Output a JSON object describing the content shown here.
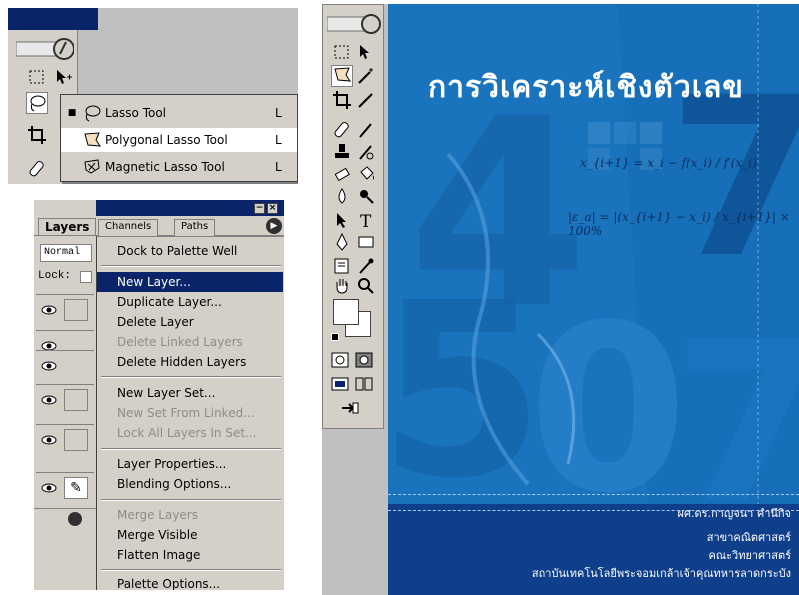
{
  "lasso_panel": {
    "flyout": {
      "items": [
        {
          "label": "Lasso Tool",
          "shortcut": "L",
          "selected": true,
          "icon": "lasso-icon"
        },
        {
          "label": "Polygonal Lasso Tool",
          "shortcut": "L",
          "selected": false,
          "icon": "polygonal-lasso-icon"
        },
        {
          "label": "Magnetic Lasso Tool",
          "shortcut": "L",
          "selected": false,
          "icon": "magnetic-lasso-icon"
        }
      ]
    }
  },
  "layers_panel": {
    "tabs": [
      "Layers",
      "Channels",
      "Paths"
    ],
    "blend_mode": "Normal",
    "lock_label": "Lock:",
    "menu": {
      "items": [
        {
          "label": "Dock to Palette Well",
          "enabled": true,
          "highlighted": false
        },
        {
          "label": "New Layer...",
          "enabled": true,
          "highlighted": true
        },
        {
          "label": "Duplicate Layer...",
          "enabled": true,
          "highlighted": false
        },
        {
          "label": "Delete Layer",
          "enabled": true,
          "highlighted": false
        },
        {
          "label": "Delete Linked Layers",
          "enabled": false,
          "highlighted": false
        },
        {
          "label": "Delete Hidden Layers",
          "enabled": true,
          "highlighted": false
        },
        {
          "label": "New Layer Set...",
          "enabled": true,
          "highlighted": false
        },
        {
          "label": "New Set From Linked...",
          "enabled": false,
          "highlighted": false
        },
        {
          "label": "Lock All Layers In Set...",
          "enabled": false,
          "highlighted": false
        },
        {
          "label": "Layer Properties...",
          "enabled": true,
          "highlighted": false
        },
        {
          "label": "Blending Options...",
          "enabled": true,
          "highlighted": false
        },
        {
          "label": "Merge Layers",
          "enabled": false,
          "highlighted": false
        },
        {
          "label": "Merge Visible",
          "enabled": true,
          "highlighted": false
        },
        {
          "label": "Flatten Image",
          "enabled": true,
          "highlighted": false
        },
        {
          "label": "Palette Options...",
          "enabled": true,
          "highlighted": false
        }
      ]
    }
  },
  "cover": {
    "title": "การวิเคราะห์เชิงตัวเลข",
    "formula_newton": "x_{i+1} = x_i − f(x_i) / f′(x_i)",
    "formula_error": "|ε_a| = |(x_{i+1} − x_i) / x_{i+1}| × 100%",
    "author": "ผศ.ดร.กาญจนา  คำนึกิจ",
    "department": "สาขาคณิตศาสตร์",
    "faculty": "คณะวิทยาศาสตร์",
    "university": "สถาบันเทคโนโลยีพระจอมเกล้าเจ้าคุณทหารลาดกระบัง",
    "background_digits": [
      "4",
      "5",
      "0",
      "7",
      "7"
    ]
  },
  "colors": {
    "menu_highlight": "#0a246a",
    "cover_blue": "#1d78c1",
    "footer_blue": "#0f3f8a"
  }
}
